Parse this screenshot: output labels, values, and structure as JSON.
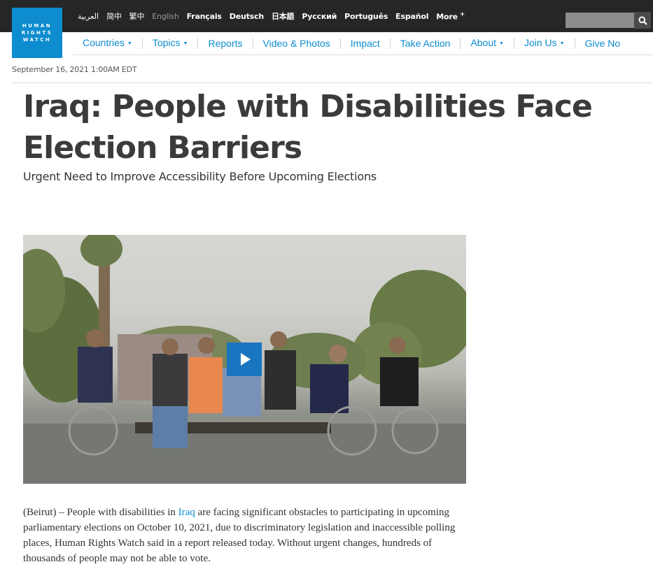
{
  "logo": {
    "lines": [
      "HUMAN",
      "RIGHTS",
      "WATCH"
    ]
  },
  "languages": [
    {
      "label": "العربية",
      "style": "normal"
    },
    {
      "label": "简中",
      "style": "normal"
    },
    {
      "label": "繁中",
      "style": "normal"
    },
    {
      "label": "English",
      "style": "muted"
    },
    {
      "label": "Français",
      "style": "bold"
    },
    {
      "label": "Deutsch",
      "style": "bold"
    },
    {
      "label": "日本語",
      "style": "bold"
    },
    {
      "label": "Русский",
      "style": "bold"
    },
    {
      "label": "Português",
      "style": "bold"
    },
    {
      "label": "Español",
      "style": "bold"
    },
    {
      "label": "More",
      "style": "bold"
    }
  ],
  "more_symbol": "+",
  "search": {
    "value": "",
    "icon": "search-icon"
  },
  "nav": [
    {
      "label": "Countries",
      "dropdown": true
    },
    {
      "label": "Topics",
      "dropdown": true
    },
    {
      "label": "Reports",
      "dropdown": false
    },
    {
      "label": "Video & Photos",
      "dropdown": false
    },
    {
      "label": "Impact",
      "dropdown": false
    },
    {
      "label": "Take Action",
      "dropdown": false
    },
    {
      "label": "About",
      "dropdown": true
    },
    {
      "label": "Join Us",
      "dropdown": true
    },
    {
      "label": "Give No",
      "dropdown": false
    }
  ],
  "dropdown_chevron": "⌄",
  "article": {
    "date": "September 16, 2021 1:00AM EDT",
    "title": "Iraq: People with Disabilities Face Election Barriers",
    "subtitle": "Urgent Need to Improve Accessibility Before Upcoming Elections",
    "body_before_link": "(Beirut) – People with disabilities in ",
    "body_link": "Iraq",
    "body_after_link": " are facing significant obstacles to participating in upcoming parliamentary elections on October 10, 2021, due to discriminatory legislation and inaccessible polling places, Human Rights Watch said in a report released today. Without urgent changes, hundreds of thousands of people may not be able to vote."
  },
  "video": {
    "play_icon": "play-icon"
  },
  "colors": {
    "brand_blue": "#0d8ccf",
    "topbar": "#262626",
    "play_button": "#1a75c0",
    "title_text": "#3b3b3b"
  }
}
